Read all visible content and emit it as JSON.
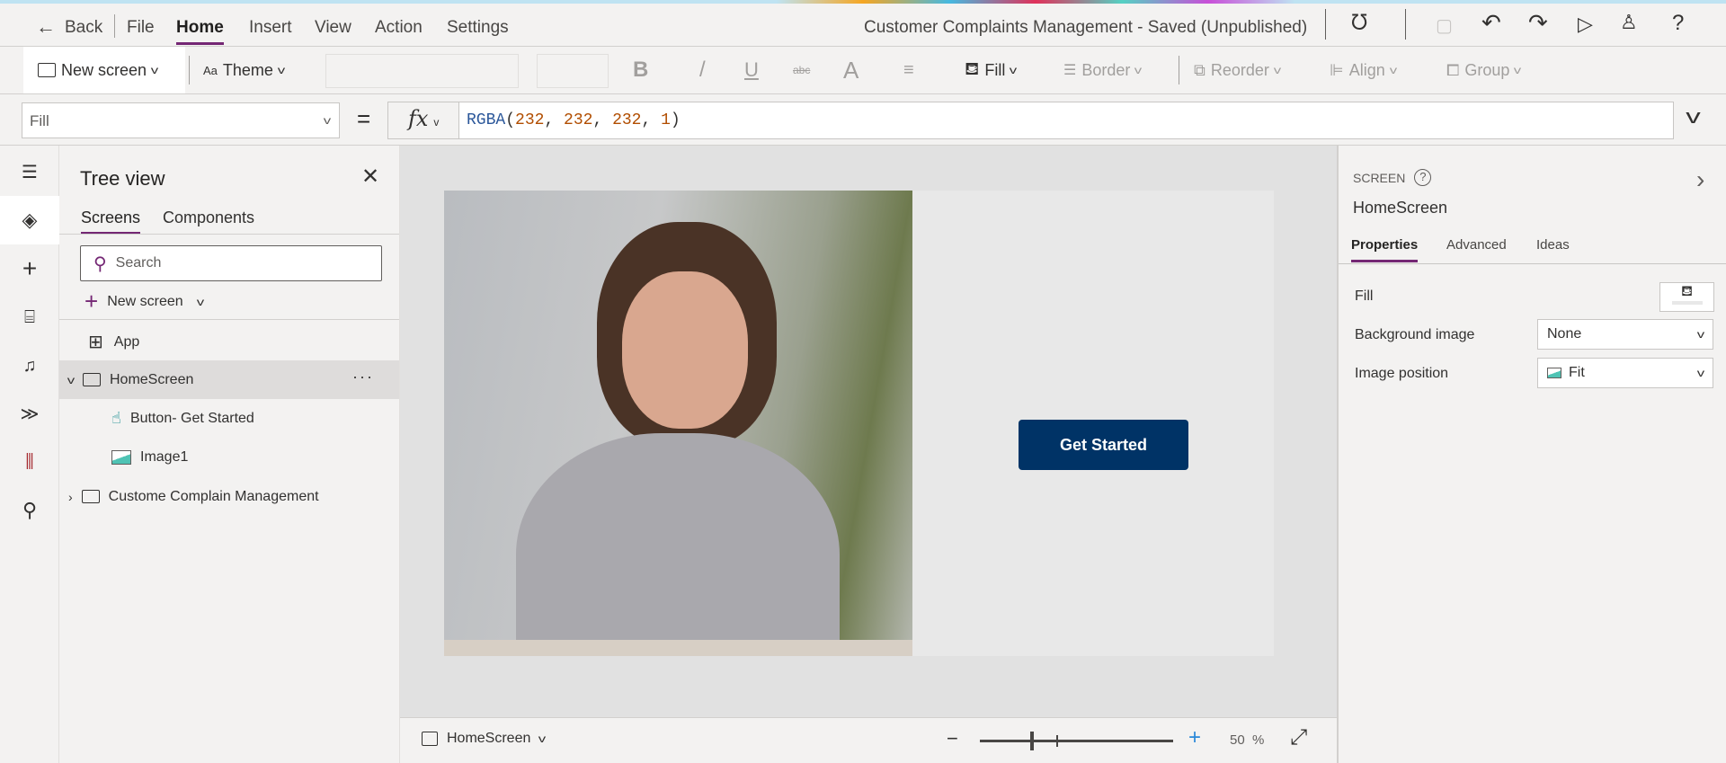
{
  "menubar": {
    "back": "Back",
    "items": [
      "File",
      "Home",
      "Insert",
      "View",
      "Action",
      "Settings"
    ],
    "active": "Home",
    "app_status": "Customer Complaints Management - Saved (Unpublished)"
  },
  "ribbon": {
    "new_screen": "New screen",
    "theme": "Theme",
    "bold": "B",
    "italic": "/",
    "underline": "U",
    "strike": "abc",
    "font_color": "A",
    "fill": "Fill",
    "border": "Border",
    "reorder": "Reorder",
    "align": "Align",
    "group": "Group"
  },
  "formula": {
    "property": "Fill",
    "equals": "=",
    "fx": "fx",
    "fn": "RGBA",
    "open": "(",
    "args": [
      "232",
      "232",
      "232",
      "1"
    ],
    "close": ")"
  },
  "tree": {
    "title": "Tree view",
    "tabs": [
      "Screens",
      "Components"
    ],
    "search_placeholder": "Search",
    "new_screen": "New screen",
    "items": [
      "App",
      "HomeScreen",
      "Button- Get Started",
      "Image1",
      "Custome Complain Management"
    ],
    "more": "···"
  },
  "canvas": {
    "button_label": "Get Started"
  },
  "bottombar": {
    "screen": "HomeScreen",
    "zoom_value": "50",
    "zoom_unit": "%",
    "zoom_fraction": 0.26
  },
  "props": {
    "kind": "SCREEN",
    "name": "HomeScreen",
    "tabs": [
      "Properties",
      "Advanced",
      "Ideas"
    ],
    "rows": {
      "fill": "Fill",
      "bg_image": "Background image",
      "bg_image_value": "None",
      "img_pos": "Image position",
      "img_pos_value": "Fit"
    }
  },
  "colors": {
    "accent": "#742774",
    "button": "#003366",
    "fill": "#e8e8e8"
  }
}
